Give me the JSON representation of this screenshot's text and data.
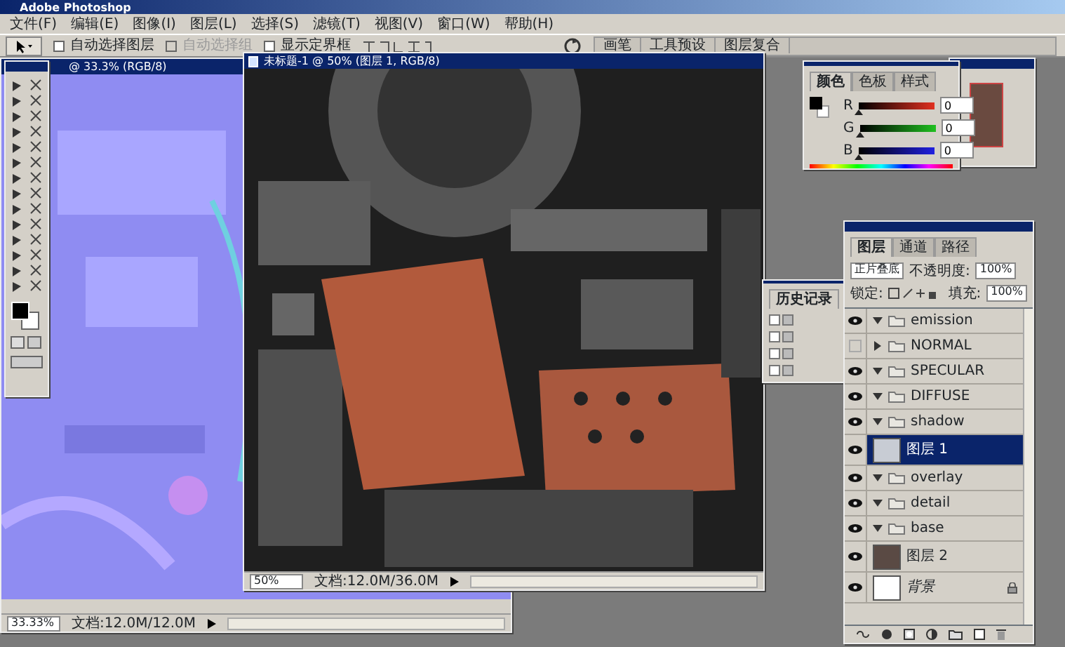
{
  "window": {
    "title": "Adobe Photoshop"
  },
  "menu": [
    "文件(F)",
    "编辑(E)",
    "图像(I)",
    "图层(L)",
    "选择(S)",
    "滤镜(T)",
    "视图(V)",
    "窗口(W)",
    "帮助(H)"
  ],
  "options_bar": {
    "checkboxes": [
      {
        "label": "自动选择图层",
        "checked": false,
        "disabled": false
      },
      {
        "label": "自动选择组",
        "checked": false,
        "disabled": true
      },
      {
        "label": "显示定界框",
        "checked": false,
        "disabled": false
      }
    ]
  },
  "palette_well": [
    "画笔",
    "工具预设",
    "图层复合"
  ],
  "documents": [
    {
      "kind": "normal-map",
      "title": "@ 33.3% (RGB/8)",
      "zoom": "33.33%",
      "doc_size": "文档:12.0M/12.0M"
    },
    {
      "kind": "texture",
      "title": "未标题-1 @ 50% (图层 1, RGB/8)",
      "zoom": "50%",
      "doc_size": "文档:12.0M/36.0M"
    }
  ],
  "color_panel": {
    "tabs": [
      {
        "label": "颜色",
        "selected": true
      },
      {
        "label": "色板",
        "selected": false
      },
      {
        "label": "样式",
        "selected": false
      }
    ],
    "channels": [
      {
        "label": "R",
        "level": 0,
        "value": "0"
      },
      {
        "label": "G",
        "level": 0,
        "value": "0"
      },
      {
        "label": "B",
        "level": 0,
        "value": "0"
      }
    ]
  },
  "history_panel": {
    "tabs": [
      {
        "label": "历史记录",
        "selected": true
      }
    ]
  },
  "layers_panel": {
    "tabs": [
      {
        "label": "图层",
        "selected": true
      },
      {
        "label": "通道",
        "selected": false
      },
      {
        "label": "路径",
        "selected": false
      }
    ],
    "blend_mode": "正片叠底",
    "opacity_label": "不透明度:",
    "opacity": "100%",
    "lock_label": "锁定:",
    "fill_label": "填充:",
    "fill": "100%",
    "layers": [
      {
        "kind": "group",
        "name": "emission",
        "visible": true,
        "expanded": true,
        "selected": false
      },
      {
        "kind": "group",
        "name": "NORMAL",
        "visible": false,
        "expanded": false,
        "selected": false
      },
      {
        "kind": "group",
        "name": "SPECULAR",
        "visible": true,
        "expanded": true,
        "selected": false
      },
      {
        "kind": "group",
        "name": "DIFFUSE",
        "visible": true,
        "expanded": true,
        "selected": false,
        "children": [
          {
            "kind": "group",
            "name": "shadow",
            "visible": true,
            "expanded": true,
            "selected": false,
            "children": [
              {
                "kind": "layer",
                "name": "图层 1",
                "visible": true,
                "selected": true
              }
            ]
          },
          {
            "kind": "group",
            "name": "overlay",
            "visible": true,
            "expanded": true,
            "selected": false
          },
          {
            "kind": "group",
            "name": "detail",
            "visible": true,
            "expanded": true,
            "selected": false
          },
          {
            "kind": "group",
            "name": "base",
            "visible": true,
            "expanded": true,
            "selected": false,
            "children": [
              {
                "kind": "layer",
                "name": "图层 2",
                "visible": true,
                "selected": false
              }
            ]
          }
        ]
      },
      {
        "kind": "background",
        "name": "背景",
        "visible": true,
        "selected": false
      }
    ]
  }
}
